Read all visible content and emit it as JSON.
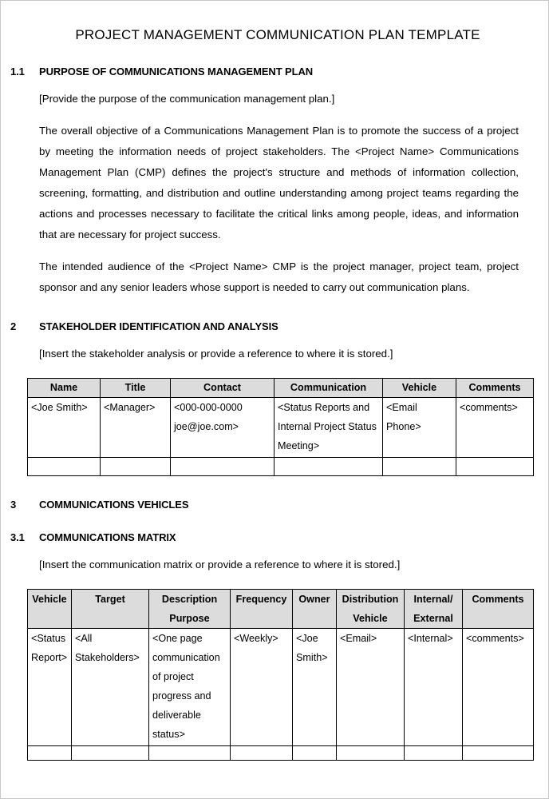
{
  "document": {
    "title": "PROJECT MANAGEMENT COMMUNICATION PLAN TEMPLATE"
  },
  "sections": [
    {
      "number": "1.1",
      "heading": "PURPOSE OF COMMUNICATIONS MANAGEMENT PLAN",
      "instruction": "[Provide the purpose of the communication management plan.]",
      "paragraph_1": "The overall objective of a Communications Management Plan is to promote the success of a project by meeting the information needs of project stakeholders. The <Project Name> Communications Management Plan (CMP) defines the project's structure and methods of information collection, screening, formatting, and distribution and outline understanding among project teams regarding the actions and processes necessary to facilitate the critical links among people, ideas, and information that are necessary for project success.",
      "paragraph_2": "The intended audience of the <Project Name> CMP is the project manager, project team, project sponsor and any senior leaders whose support is needed to carry out communication plans."
    },
    {
      "number": "2",
      "heading": "STAKEHOLDER IDENTIFICATION AND ANALYSIS",
      "instruction": "[Insert the stakeholder analysis or provide a reference to where it is stored.]"
    },
    {
      "number": "3",
      "heading": "COMMUNICATIONS VEHICLES"
    },
    {
      "number": "3.1",
      "heading": "COMMUNICATIONS MATRIX",
      "instruction": "[Insert the communication matrix or provide a reference to where it is stored.]"
    }
  ],
  "stakeholder_table": {
    "headers": [
      "Name",
      "Title",
      "Contact",
      "Communication",
      "Vehicle",
      "Comments"
    ],
    "rows": [
      [
        "<Joe Smith>",
        "<Manager>",
        "<000-000-0000 joe@joe.com>",
        "<Status Reports and Internal Project Status Meeting>",
        "<Email Phone>",
        "<comments>"
      ],
      [
        "",
        "",
        "",
        "",
        "",
        ""
      ]
    ]
  },
  "matrix_table": {
    "headers": [
      "Vehicle",
      "Target",
      "Description Purpose",
      "Frequency",
      "Owner",
      "Distribution Vehicle",
      "Internal/ External",
      "Comments"
    ],
    "rows": [
      [
        "<Status Report>",
        "<All Stakeholders>",
        "<One page communication of project progress and deliverable status>",
        "<Weekly>",
        "<Joe Smith>",
        "<Email>",
        "<Internal>",
        "<comments>"
      ],
      [
        "",
        "",
        "",
        "",
        "",
        "",
        "",
        ""
      ]
    ]
  },
  "colors": {
    "table_header_background": "#dcdcdc",
    "table_border": "#000000",
    "page_border": "#c8c8c8",
    "text": "#000000"
  }
}
